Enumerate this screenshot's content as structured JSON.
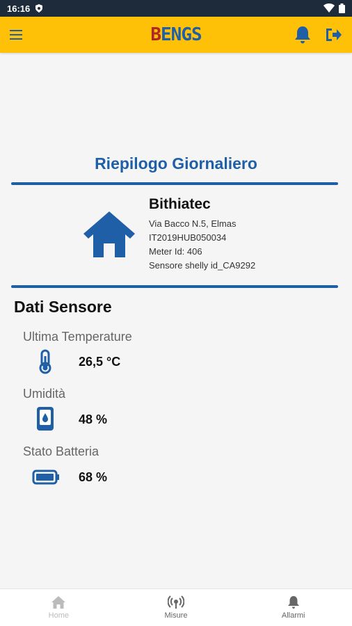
{
  "status_bar": {
    "time": "16:16"
  },
  "app_bar": {
    "logo_first": "B",
    "logo_rest": "ENGS"
  },
  "page_title": "Riepilogo Giornaliero",
  "site": {
    "name": "Bithiatec",
    "address": "Via Bacco N.5, Elmas",
    "code": "IT2019HUB050034",
    "meter": "Meter Id: 406",
    "sensor": "Sensore shelly id_CA9292"
  },
  "sensor_section": {
    "title": "Dati Sensore",
    "temperature": {
      "label": "Ultima Temperature",
      "value": "26,5 °C"
    },
    "humidity": {
      "label": "Umidità",
      "value": "48 %"
    },
    "battery": {
      "label": "Stato Batteria",
      "value": "68 %"
    }
  },
  "bottom_nav": [
    {
      "label": "Home"
    },
    {
      "label": "Misure"
    },
    {
      "label": "Allarmi"
    }
  ],
  "colors": {
    "accent": "#1f5fa8",
    "app_bar": "#ffc107",
    "logo_b": "#b0281f"
  }
}
